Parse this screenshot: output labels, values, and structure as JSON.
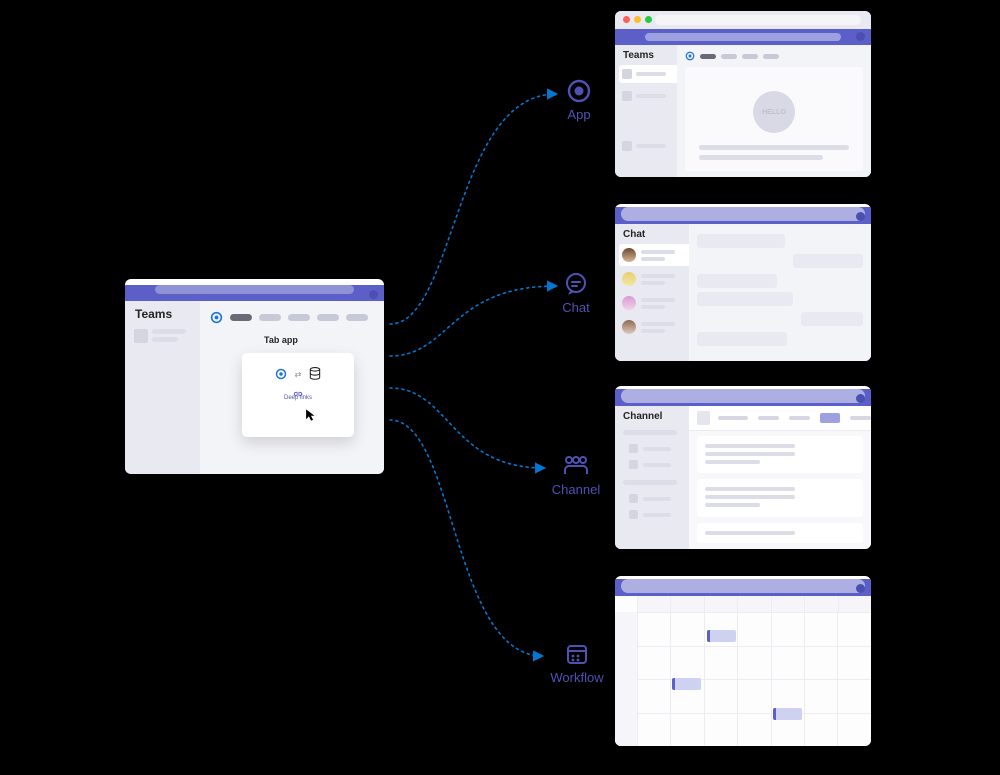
{
  "source": {
    "sidebar_title": "Teams",
    "tab_title": "Tab app",
    "card_link_label": "Deep links"
  },
  "targets": {
    "app": {
      "label": "App",
      "sidebar_title": "Teams",
      "hello": "HELLO"
    },
    "chat": {
      "label": "Chat",
      "sidebar_title": "Chat"
    },
    "channel": {
      "label": "Channel",
      "sidebar_title": "Channel"
    },
    "workflow": {
      "label": "Workflow"
    }
  },
  "colors": {
    "brand": "#5b5fc7",
    "brand_text": "#4f52b2",
    "connector": "#0078d4"
  },
  "icons": {
    "app": "concentric-circle-icon",
    "chat": "chat-bubble-icon",
    "channel": "people-group-icon",
    "workflow": "calendar-dots-icon",
    "logo": "swirl-logo-icon",
    "server": "server-stack-icon",
    "link": "chain-link-icon",
    "cursor": "mouse-cursor-icon"
  }
}
